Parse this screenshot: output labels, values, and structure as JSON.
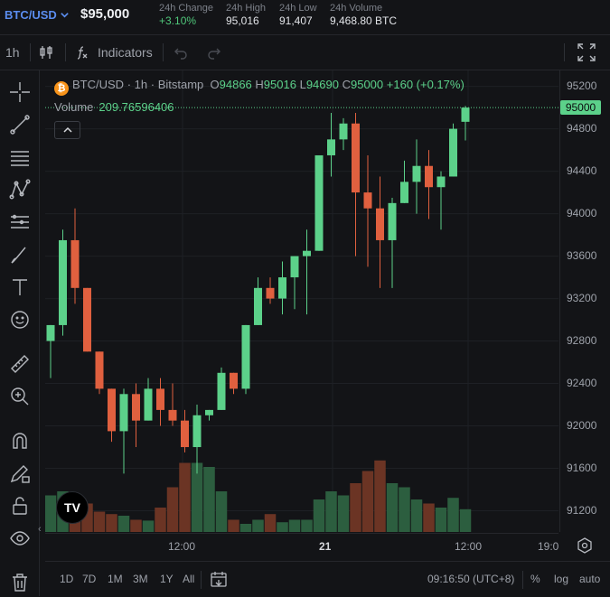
{
  "header": {
    "pair": "BTC/USD",
    "price": "$95,000",
    "stats": [
      {
        "label": "24h Change",
        "value": "+3.10%",
        "positive": true
      },
      {
        "label": "24h High",
        "value": "95,016"
      },
      {
        "label": "24h Low",
        "value": "91,407"
      },
      {
        "label": "24h Volume",
        "value": "9,468.80 BTC"
      }
    ]
  },
  "toolbar": {
    "interval": "1h",
    "indicators": "Indicators"
  },
  "legend": {
    "symbol": "BTC/USD",
    "interval": "1h",
    "exchange": "Bitstamp",
    "open_label": "O",
    "open": "94866",
    "high_label": "H",
    "high": "95016",
    "low_label": "L",
    "low": "94690",
    "close_label": "C",
    "close": "95000",
    "change": "+160 (+0.17%)",
    "volume_label": "Volume",
    "volume": "209.76596406"
  },
  "price_axis": {
    "ticks": [
      "95200",
      "94800",
      "94400",
      "94000",
      "93600",
      "93200",
      "92800",
      "92400",
      "92000",
      "91600",
      "91200"
    ],
    "current": "95000"
  },
  "time_axis": {
    "ticks": [
      "12:00",
      "21",
      "12:00",
      "19:0"
    ]
  },
  "bottom": {
    "ranges": [
      "1D",
      "7D",
      "1M",
      "3M",
      "1Y",
      "All"
    ],
    "clock": "09:16:50 (UTC+8)",
    "percent": "%",
    "log": "log",
    "auto": "auto"
  },
  "logo_text": "TV",
  "colors": {
    "up": "#5cd18a",
    "down": "#e0603f",
    "volUp": "#2c5e3f",
    "volDown": "#6b3424"
  },
  "chart_data": {
    "type": "candlestick",
    "ylim": [
      91000,
      95350
    ],
    "candles": [
      {
        "o": 92800,
        "h": 92950,
        "l": 92450,
        "c": 92950,
        "v": 0.45
      },
      {
        "o": 92950,
        "h": 93850,
        "l": 92850,
        "c": 93750,
        "v": 0.5
      },
      {
        "o": 93750,
        "h": 94050,
        "l": 93150,
        "c": 93300,
        "v": 0.45
      },
      {
        "o": 93300,
        "h": 93250,
        "l": 92700,
        "c": 92700,
        "v": 0.35
      },
      {
        "o": 92700,
        "h": 92700,
        "l": 92300,
        "c": 92350,
        "v": 0.25
      },
      {
        "o": 92350,
        "h": 92350,
        "l": 91850,
        "c": 91950,
        "v": 0.22
      },
      {
        "o": 91950,
        "h": 92350,
        "l": 91550,
        "c": 92300,
        "v": 0.2
      },
      {
        "o": 92300,
        "h": 92400,
        "l": 91800,
        "c": 92050,
        "v": 0.15
      },
      {
        "o": 92050,
        "h": 92450,
        "l": 92050,
        "c": 92350,
        "v": 0.14
      },
      {
        "o": 92350,
        "h": 92450,
        "l": 92000,
        "c": 92150,
        "v": 0.3
      },
      {
        "o": 92150,
        "h": 92400,
        "l": 92000,
        "c": 92050,
        "v": 0.55
      },
      {
        "o": 92050,
        "h": 92150,
        "l": 91750,
        "c": 91800,
        "v": 0.85
      },
      {
        "o": 91800,
        "h": 92200,
        "l": 91550,
        "c": 92100,
        "v": 0.85
      },
      {
        "o": 92100,
        "h": 92150,
        "l": 92050,
        "c": 92150,
        "v": 0.8
      },
      {
        "o": 92150,
        "h": 92550,
        "l": 92150,
        "c": 92500,
        "v": 0.5
      },
      {
        "o": 92500,
        "h": 92500,
        "l": 92300,
        "c": 92350,
        "v": 0.15
      },
      {
        "o": 92350,
        "h": 92950,
        "l": 92300,
        "c": 92950,
        "v": 0.1
      },
      {
        "o": 92950,
        "h": 93400,
        "l": 92950,
        "c": 93300,
        "v": 0.15
      },
      {
        "o": 93300,
        "h": 93400,
        "l": 93150,
        "c": 93200,
        "v": 0.22
      },
      {
        "o": 93200,
        "h": 93550,
        "l": 93050,
        "c": 93400,
        "v": 0.12
      },
      {
        "o": 93400,
        "h": 93600,
        "l": 93100,
        "c": 93600,
        "v": 0.15
      },
      {
        "o": 93600,
        "h": 93850,
        "l": 93050,
        "c": 93650,
        "v": 0.15
      },
      {
        "o": 93650,
        "h": 94450,
        "l": 93650,
        "c": 94550,
        "v": 0.4
      },
      {
        "o": 94550,
        "h": 94950,
        "l": 94350,
        "c": 94700,
        "v": 0.5
      },
      {
        "o": 94700,
        "h": 94900,
        "l": 94600,
        "c": 94850,
        "v": 0.45
      },
      {
        "o": 94850,
        "h": 94950,
        "l": 93600,
        "c": 94200,
        "v": 0.6
      },
      {
        "o": 94200,
        "h": 94550,
        "l": 93500,
        "c": 94050,
        "v": 0.75
      },
      {
        "o": 94050,
        "h": 94350,
        "l": 93300,
        "c": 93750,
        "v": 0.88
      },
      {
        "o": 93750,
        "h": 94150,
        "l": 93300,
        "c": 94100,
        "v": 0.6
      },
      {
        "o": 94100,
        "h": 94500,
        "l": 94100,
        "c": 94300,
        "v": 0.55
      },
      {
        "o": 94300,
        "h": 94700,
        "l": 94000,
        "c": 94450,
        "v": 0.4
      },
      {
        "o": 94450,
        "h": 94600,
        "l": 93950,
        "c": 94250,
        "v": 0.35
      },
      {
        "o": 94250,
        "h": 94400,
        "l": 93850,
        "c": 94350,
        "v": 0.3
      },
      {
        "o": 94350,
        "h": 94850,
        "l": 94350,
        "c": 94800,
        "v": 0.42
      },
      {
        "o": 94866,
        "h": 95016,
        "l": 94690,
        "c": 95000,
        "v": 0.28
      }
    ]
  }
}
